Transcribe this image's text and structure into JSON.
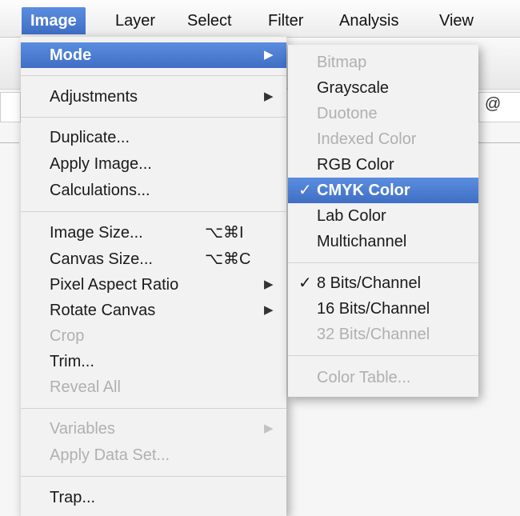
{
  "menubar": {
    "items": [
      {
        "label": "Image",
        "active": true
      },
      {
        "label": "Layer"
      },
      {
        "label": "Select"
      },
      {
        "label": "Filter"
      },
      {
        "label": "Analysis"
      },
      {
        "label": "View"
      }
    ]
  },
  "image_menu": {
    "mode": "Mode",
    "adjustments": "Adjustments",
    "duplicate": "Duplicate...",
    "apply_image": "Apply Image...",
    "calculations": "Calculations...",
    "image_size": {
      "label": "Image Size...",
      "shortcut": "⌥⌘I"
    },
    "canvas_size": {
      "label": "Canvas Size...",
      "shortcut": "⌥⌘C"
    },
    "pixel_aspect_ratio": "Pixel Aspect Ratio",
    "rotate_canvas": "Rotate Canvas",
    "crop": "Crop",
    "trim": "Trim...",
    "reveal_all": "Reveal All",
    "variables": "Variables",
    "apply_data_set": "Apply Data Set...",
    "trap": "Trap..."
  },
  "mode_submenu": {
    "bitmap": "Bitmap",
    "grayscale": "Grayscale",
    "duotone": "Duotone",
    "indexed_color": "Indexed Color",
    "rgb_color": "RGB Color",
    "cmyk_color": "CMYK Color",
    "lab_color": "Lab Color",
    "multichannel": "Multichannel",
    "bits_8": "8 Bits/Channel",
    "bits_16": "16 Bits/Channel",
    "bits_32": "32 Bits/Channel",
    "color_table": "Color Table...",
    "checkmark": "✓",
    "checked_items": [
      "CMYK Color",
      "8 Bits/Channel"
    ]
  },
  "icons": {
    "submenu_arrow": "▶"
  },
  "backdrop": {
    "at_sign": "@"
  },
  "colors": {
    "highlight": "#4a7fd6",
    "disabled_text": "#b0b0b0",
    "menu_bg": "#f2f2f2"
  }
}
